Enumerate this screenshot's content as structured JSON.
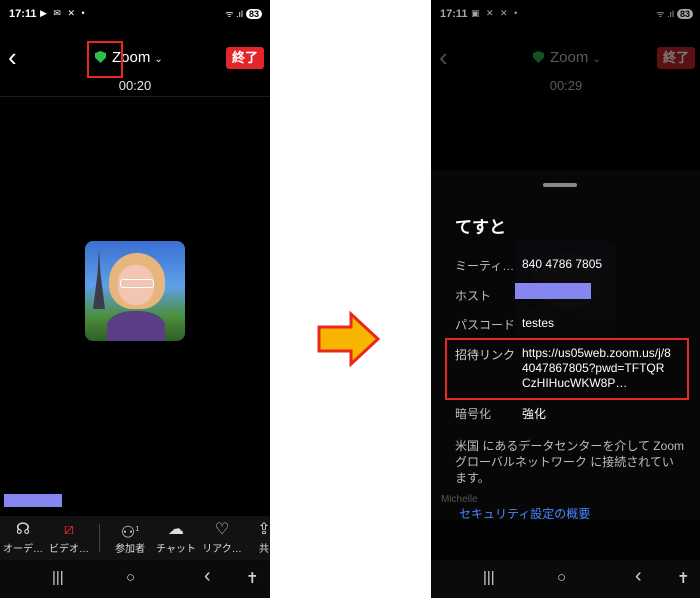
{
  "left_screen": {
    "status": {
      "time": "17:11",
      "icons": "▶ ✉ ✕ •",
      "right": "ᯤ .ıl",
      "battery": "83"
    },
    "header": {
      "title": "Zoom",
      "end_label": "終了"
    },
    "timer": "00:20",
    "toolbar": [
      {
        "label": "オーデ…",
        "icon": "headphones-icon"
      },
      {
        "label": "ビデオ…",
        "icon": "video-off-icon"
      },
      {
        "label": "参加者",
        "icon": "participants-icon",
        "badge": "1"
      },
      {
        "label": "チャット",
        "icon": "chat-icon"
      },
      {
        "label": "リアク…",
        "icon": "heart-icon"
      },
      {
        "label": "共",
        "icon": "share-icon"
      }
    ]
  },
  "right_screen": {
    "status": {
      "time": "17:11",
      "icons": "▣ ✕ ✕ •",
      "right": "ᯤ .ıl",
      "battery": "83"
    },
    "header": {
      "title": "Zoom",
      "end_label": "終了"
    },
    "timer": "00:29",
    "info": {
      "meeting_title": "てすと",
      "meeting_id_label": "ミーティ…",
      "meeting_id": "840 4786 7805",
      "host_label": "ホスト",
      "passcode_label": "パスコード",
      "passcode": "testes",
      "invite_label": "招待リンク",
      "invite_link": "https://us05web.zoom.us/j/84047867805?pwd=TFTQRCzHIHucWKW8P…",
      "encryption_label": "暗号化",
      "encryption_value": "強化",
      "security_note": "米国 にあるデータセンターを介して Zoomグローバルネットワーク に接続されています。",
      "partial_name": "Michelle",
      "security_link": "セキュリティ設定の概要"
    }
  },
  "nav": {
    "recents": "|||",
    "home": "○",
    "back": "‹",
    "accessibility": "✝"
  },
  "colors": {
    "highlight": "#e8281e",
    "end_button": "#e3262a",
    "shield": "#2fbf4e",
    "link": "#4a86ff",
    "arrow_fill": "#f7b500",
    "arrow_stroke": "#e8281e"
  }
}
